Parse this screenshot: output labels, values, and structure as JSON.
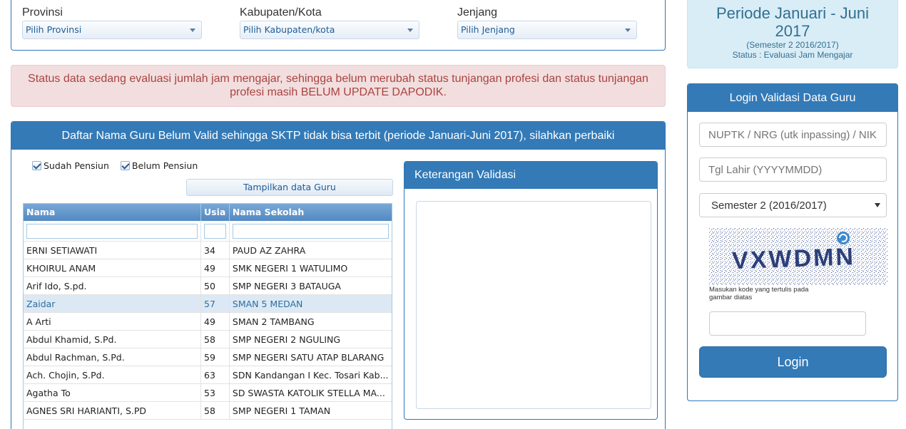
{
  "filters": [
    {
      "label": "Provinsi",
      "value": "Pilih Provinsi"
    },
    {
      "label": "Kabupaten/Kota",
      "value": "Pilih Kabupaten/kota"
    },
    {
      "label": "Jenjang",
      "value": "Pilih Jenjang"
    }
  ],
  "alert": {
    "text": "Status data sedang evaluasi jumlah jam mengajar, sehingga belum merubah status tunjangan profesi dan status tunjangan profesi masih BELUM UPDATE DAPODIK."
  },
  "main_panel": {
    "title": "Daftar Nama Guru Belum Valid sehingga SKTP tidak bisa terbit (periode Januari-Juni 2017), silahkan perbaiki",
    "checkboxes": [
      {
        "label": "Sudah Pensiun",
        "checked": true
      },
      {
        "label": "Belum Pensiun",
        "checked": true
      }
    ],
    "show_button": "Tampilkan data Guru",
    "grid": {
      "columns": [
        "Nama",
        "Usia",
        "Nama Sekolah"
      ],
      "rows": [
        {
          "nama": "ERNI SETIAWATI",
          "usia": "34",
          "sekolah": "PAUD AZ ZAHRA"
        },
        {
          "nama": "KHOIRUL ANAM",
          "usia": "49",
          "sekolah": "SMK NEGERI 1 WATULIMO"
        },
        {
          "nama": "Arif Ido, S.pd.",
          "usia": "50",
          "sekolah": "SMP NEGERI 3 BATAUGA"
        },
        {
          "nama": "Zaidar",
          "usia": "57",
          "sekolah": "SMAN 5 MEDAN"
        },
        {
          "nama": "A Arti",
          "usia": "49",
          "sekolah": "SMAN 2 TAMBANG"
        },
        {
          "nama": "Abdul Khamid, S.Pd.",
          "usia": "58",
          "sekolah": "SMP NEGERI 2 NGULING"
        },
        {
          "nama": "Abdul Rachman, S.Pd.",
          "usia": "59",
          "sekolah": "SMP NEGERI SATU ATAP BLARANG"
        },
        {
          "nama": "Ach. Chojin, S.Pd.",
          "usia": "63",
          "sekolah": "SDN Kandangan I Kec. Tosari Kab..."
        },
        {
          "nama": "Agatha To",
          "usia": "53",
          "sekolah": "SD SWASTA KATOLIK STELLA MA..."
        },
        {
          "nama": "AGNES SRI HARIANTI, S.PD",
          "usia": "58",
          "sekolah": "SMP NEGERI 1 TAMAN"
        }
      ],
      "selected_row_index": 3
    }
  },
  "keterangan": {
    "title": "Keterangan Validasi"
  },
  "periode": {
    "title": "Periode Januari - Juni 2017",
    "semester": "(Semester 2 2016/2017)",
    "status": "Status : Evaluasi Jam Mengajar"
  },
  "login": {
    "title": "Login Validasi Data Guru",
    "nuptk_placeholder": "NUPTK / NRG (utk inpassing) / NIK",
    "tgl_placeholder": "Tgl Lahir (YYYYMMDD)",
    "semester_value": "Semester 2 (2016/2017)",
    "captcha_text": "VXWDMN",
    "captcha_hint": "Masukan kode yang tertulis pada gambar diatas",
    "button": "Login"
  },
  "colors": {
    "primary": "#337ab7",
    "alert_bg": "#f2dede",
    "alert_text": "#a94442",
    "info_bg": "#d9edf7",
    "info_text": "#31708f"
  }
}
